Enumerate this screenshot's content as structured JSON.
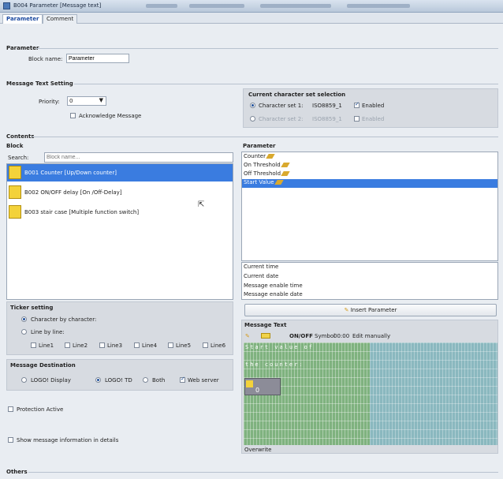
{
  "window": {
    "title": "B004 Parameter [Message text]"
  },
  "tabs": [
    {
      "label": "Parameter",
      "active": true
    },
    {
      "label": "Comment",
      "active": false
    }
  ],
  "parameter_section": {
    "title": "Parameter",
    "block_name_label": "Block name:",
    "block_name_value": "Parameter"
  },
  "message_text_setting": {
    "title": "Message Text Setting",
    "priority_label": "Priority:",
    "priority_value": "0",
    "acknowledge_label": "Acknowledge Message",
    "charset": {
      "title": "Current character set selection",
      "set1_label": "Character set 1:",
      "set1_value": "ISO8859_1",
      "set1_enabled_label": "Enabled",
      "set2_label": "Character set 2:",
      "set2_value": "ISO8859_1",
      "set2_enabled_label": "Enabled"
    }
  },
  "contents": {
    "title": "Contents",
    "block_title": "Block",
    "search_label": "Search:",
    "search_placeholder": "Block name...",
    "blocks": [
      {
        "label": "B001 Counter [Up/Down counter]",
        "selected": true
      },
      {
        "label": "B002 ON/OFF delay [On /Off-Delay]",
        "selected": false
      },
      {
        "label": "B003 stair case [Multiple function switch]",
        "selected": false
      }
    ],
    "parameter_title": "Parameter",
    "parameters": [
      {
        "label": "Counter",
        "selected": false
      },
      {
        "label": "On Threshold",
        "selected": false
      },
      {
        "label": "Off Threshold",
        "selected": false
      },
      {
        "label": "Start Value",
        "selected": true
      }
    ],
    "extras": [
      "Current time",
      "Current date",
      "Message enable time",
      "Message enable date"
    ],
    "insert_button": "Insert Parameter"
  },
  "ticker": {
    "title": "Ticker setting",
    "char_label": "Character by character:",
    "line_label": "Line by line:",
    "lines": [
      "Line1",
      "Line2",
      "Line3",
      "Line4",
      "Line5",
      "Line6"
    ]
  },
  "destination": {
    "title": "Message Destination",
    "options": [
      "LOGO! Display",
      "LOGO! TD",
      "Both"
    ],
    "web_server_label": "Web server"
  },
  "protection_label": "Protection Active",
  "show_info_label": "Show message information in details",
  "message_text": {
    "title": "Message Text",
    "toolbar_onoff": "ON/OFF",
    "toolbar_symbol": "Symbol",
    "toolbar_time": "00:00",
    "toolbar_edit": "Edit manually",
    "line1": "Start value of",
    "line2": "the counter:",
    "field_value": "0",
    "status": "Overwrite"
  },
  "others_title": "Others",
  "colors": {
    "accent": "#3a7ce0",
    "lcd_green": "#7fb27f",
    "lcd_teal": "#8ab8bf"
  }
}
